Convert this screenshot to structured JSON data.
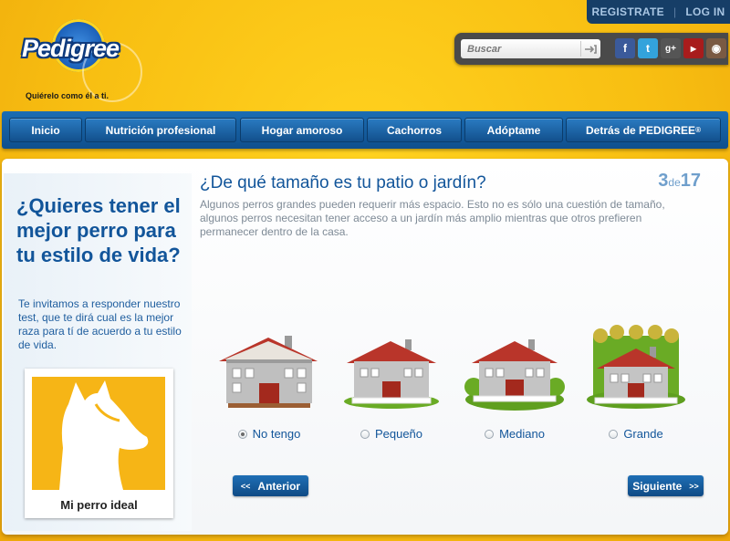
{
  "account": {
    "register": "REGISTRATE",
    "separator": "|",
    "login": "LOG IN"
  },
  "brand": {
    "name": "Pedigree",
    "tagline": "Quiérelo como él a ti."
  },
  "search": {
    "placeholder": "Buscar"
  },
  "social": [
    "facebook-icon",
    "twitter-icon",
    "google-plus-icon",
    "youtube-icon",
    "instagram-icon"
  ],
  "nav": {
    "items": [
      "Inicio",
      "Nutrición profesional",
      "Hogar amoroso",
      "Cachorros",
      "Adóptame",
      "Detrás de PEDIGREE"
    ],
    "last_mark": "®"
  },
  "sidebar": {
    "headline": "¿Quieres tener el mejor perro para tu estilo de vida?",
    "intro": "Te invitamos a responder nuestro test, que te dirá cual es la mejor raza para tí de acuerdo a tu estilo de vida.",
    "card_label": "Mi perro ideal"
  },
  "question": {
    "title": "¿De qué tamaño es tu patio o jardín?",
    "current": "3",
    "of": "de",
    "total": "17",
    "description": "Algunos perros grandes pueden requerir más espacio. Esto no es sólo una cuestión de tamaño, algunos perros necesitan tener acceso a un jardín más amplio mientras que otros prefieren permanecer dentro de la casa."
  },
  "options": [
    {
      "label": "No tengo",
      "selected": true
    },
    {
      "label": "Pequeño",
      "selected": false
    },
    {
      "label": "Mediano",
      "selected": false
    },
    {
      "label": "Grande",
      "selected": false
    }
  ],
  "buttons": {
    "prev": "Anterior",
    "next": "Siguiente",
    "prev_arrow": "<<",
    "next_arrow": ">>"
  },
  "colors": {
    "brand_blue": "#12559a",
    "background_yellow": "#f8bf12",
    "roof_red": "#a3291d",
    "grass_green": "#6aab25"
  }
}
